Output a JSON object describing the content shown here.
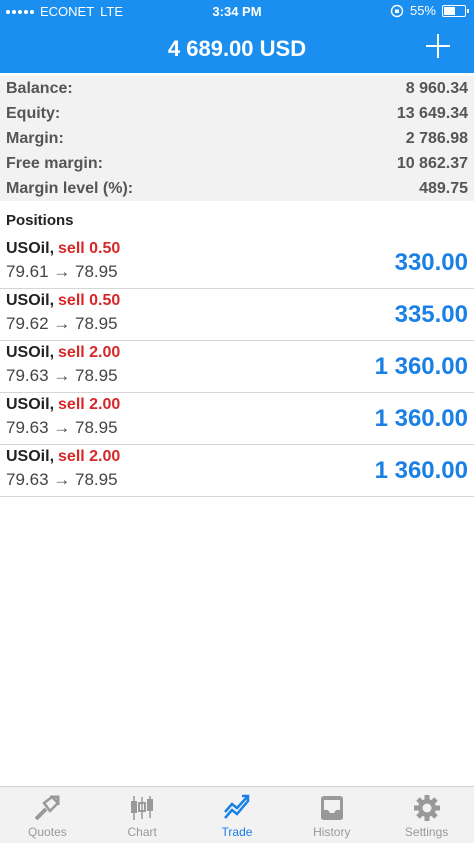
{
  "status_bar": {
    "carrier": "ECONET",
    "network": "LTE",
    "time": "3:34 PM",
    "battery": "55%",
    "battery_level": 0.55
  },
  "header": {
    "balance_title": "4 689.00 USD"
  },
  "summary": [
    {
      "label": "Balance:",
      "value": "8 960.34"
    },
    {
      "label": "Equity:",
      "value": "13 649.34"
    },
    {
      "label": "Margin:",
      "value": "2 786.98"
    },
    {
      "label": "Free margin:",
      "value": "10 862.37"
    },
    {
      "label": "Margin level (%):",
      "value": "489.75"
    }
  ],
  "positions_label": "Positions",
  "positions": [
    {
      "symbol": "USOil,",
      "side": "sell 0.50",
      "prices": "79.61 → 78.95",
      "profit": "330.00"
    },
    {
      "symbol": "USOil,",
      "side": "sell 0.50",
      "prices": "79.62 → 78.95",
      "profit": "335.00"
    },
    {
      "symbol": "USOil,",
      "side": "sell 2.00",
      "prices": "79.63 → 78.95",
      "profit": "1 360.00"
    },
    {
      "symbol": "USOil,",
      "side": "sell 2.00",
      "prices": "79.63 → 78.95",
      "profit": "1 360.00"
    },
    {
      "symbol": "USOil,",
      "side": "sell 2.00",
      "prices": "79.63 → 78.95",
      "profit": "1 360.00"
    }
  ],
  "tabs": [
    {
      "label": "Quotes",
      "icon": "quotes-icon"
    },
    {
      "label": "Chart",
      "icon": "chart-icon"
    },
    {
      "label": "Trade",
      "icon": "trade-icon",
      "active": true
    },
    {
      "label": "History",
      "icon": "history-icon"
    },
    {
      "label": "Settings",
      "icon": "settings-icon"
    }
  ],
  "colors": {
    "header_bg": "#1a8ff0",
    "profit": "#1a80e6",
    "sell": "#d62828",
    "tab_active": "#1a80e6",
    "tab_inactive": "#999999"
  }
}
